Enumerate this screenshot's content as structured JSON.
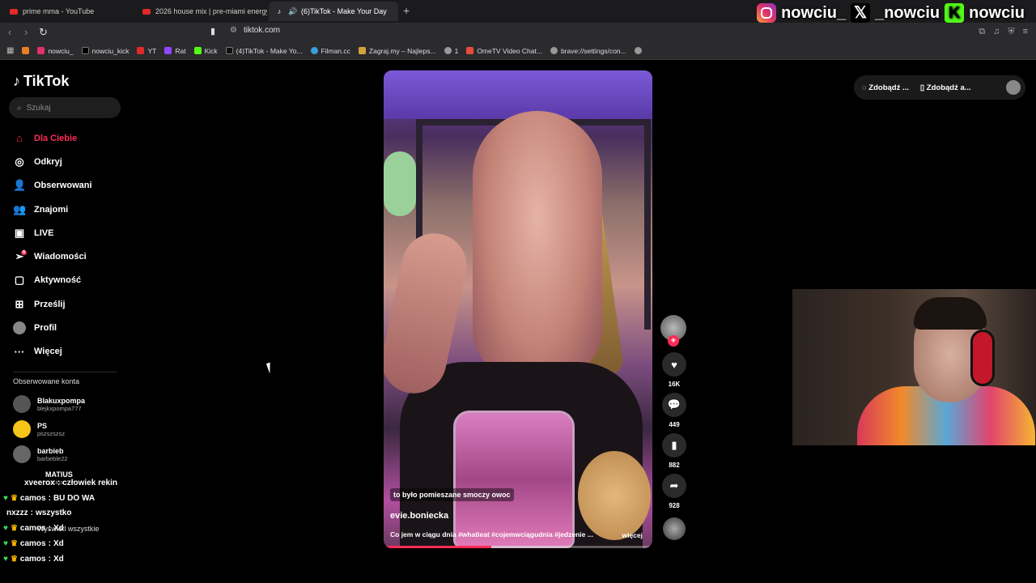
{
  "browser": {
    "tabs": [
      {
        "label": "prime mma - YouTube",
        "icon": "youtube-icon"
      },
      {
        "label": "2026 house mix | pre-miami energy",
        "icon": "youtube-icon"
      },
      {
        "label": "(6)TikTok - Make Your Day",
        "icon": "tiktok-icon",
        "active": true
      }
    ],
    "url": "tiktok.com",
    "bookmarks": [
      "nowciu_",
      "nowciu_kick",
      "YT",
      "Rat",
      "Kick",
      "(4)TikTok - Make Yo...",
      "Filman.cc",
      "Zagraj.my – Najleps...",
      "1",
      "OmeTV Video Chat...",
      "brave://settings/con..."
    ]
  },
  "overlay": {
    "instagram": "nowciu_",
    "x": "_nowciu",
    "kick": "nowciu"
  },
  "sidebar": {
    "logo": "TikTok",
    "search_placeholder": "Szukaj",
    "menu": [
      {
        "label": "Dla Ciebie",
        "icon": "home-icon"
      },
      {
        "label": "Odkryj",
        "icon": "compass-icon"
      },
      {
        "label": "Obserwowani",
        "icon": "following-icon"
      },
      {
        "label": "Znajomi",
        "icon": "friends-icon"
      },
      {
        "label": "LIVE",
        "icon": "live-icon"
      },
      {
        "label": "Wiadomości",
        "icon": "messages-icon",
        "badge": "6"
      },
      {
        "label": "Aktywność",
        "icon": "activity-icon"
      },
      {
        "label": "Prześlij",
        "icon": "upload-icon"
      },
      {
        "label": "Profil",
        "icon": "profile-icon"
      },
      {
        "label": "Więcej",
        "icon": "more-icon"
      }
    ],
    "followed_title": "Obserwowane konta",
    "accounts": [
      {
        "name": "Blakuxpompa",
        "handle": "blejkxpompa777"
      },
      {
        "name": "PS",
        "handle": "pszszszsz"
      },
      {
        "name": "barbieb",
        "handle": "barbeble22"
      },
      {
        "name": "MATIUS",
        "handle": "matius"
      }
    ]
  },
  "chat": {
    "lines": [
      {
        "user": "xveerox",
        "text": "człowiek rekin"
      },
      {
        "user": "camos",
        "text": "BU DO WA"
      },
      {
        "user": "nxzzz",
        "text": "wszystko"
      },
      {
        "user": "camos",
        "text": "Xd"
      },
      {
        "user": "camos",
        "text": "Xd"
      },
      {
        "user": "camos",
        "text": "Xd"
      }
    ],
    "show_all": "Wyświetl wszystkie"
  },
  "video": {
    "caption": "to było pomieszane smoczy owoc",
    "author": "evie.boniecka",
    "description": "Co jem w ciągu dnia #whatieat #cojemwciągudnia #jedzenie ...",
    "more": "więcej",
    "progress": 0.4
  },
  "actions": {
    "likes": "16K",
    "comments": "449",
    "saves": "882",
    "shares": "928"
  },
  "topright": {
    "btn1": "Zdobądź ...",
    "btn2": "Zdobądź a..."
  }
}
